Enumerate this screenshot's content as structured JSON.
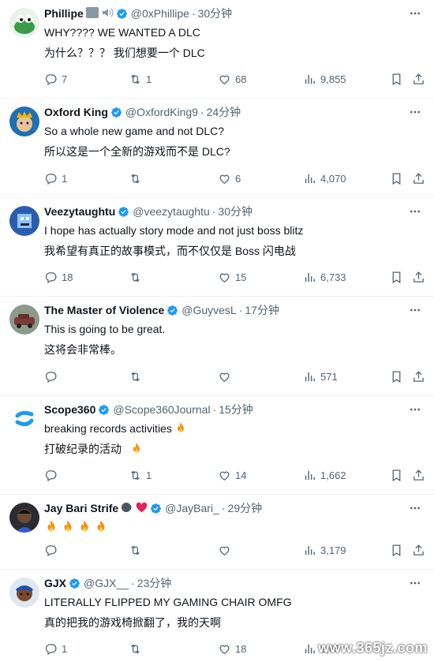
{
  "icons": {
    "verified": "verified-badge-icon",
    "more": "more-icon",
    "reply": "reply-icon",
    "retweet": "retweet-icon",
    "like": "heart-icon",
    "views": "views-icon",
    "bookmark": "bookmark-icon",
    "share": "share-icon",
    "fire": "fire-emoji"
  },
  "colors": {
    "verified": "#1d9bf0",
    "text": "#0f1419",
    "muted": "#536471",
    "divider": "#eff3f4"
  },
  "tweets": [
    {
      "name": "Phillipe",
      "handle": "@0xPhillipe",
      "time": "30分钟",
      "text": "WHY???? WE WANTED A DLC",
      "translation": "为什么？？？ 我们想要一个 DLC",
      "replies": "7",
      "retweets": "1",
      "likes": "68",
      "views": "9,855"
    },
    {
      "name": "Oxford King",
      "handle": "@OxfordKing9",
      "time": "24分钟",
      "text": "So a whole new game and not DLC?",
      "translation": "所以这是一个全新的游戏而不是 DLC?",
      "replies": "1",
      "retweets": "",
      "likes": "6",
      "views": "4,070"
    },
    {
      "name": "Veezytaughtu",
      "handle": "@veezytaughtu",
      "time": "30分钟",
      "text": "I hope has actually story mode and not just boss blitz",
      "translation": "我希望有真正的故事模式，而不仅仅是 Boss 闪电战",
      "replies": "18",
      "retweets": "",
      "likes": "15",
      "views": "6,733"
    },
    {
      "name": "The Master of Violence",
      "handle": "@GuyvesL",
      "time": "17分钟",
      "text": "This is going to be great.",
      "translation": "这将会非常棒。",
      "replies": "",
      "retweets": "",
      "likes": "",
      "views": "571"
    },
    {
      "name": "Scope360",
      "handle": "@Scope360Journal",
      "time": "15分钟",
      "text": "breaking records activities",
      "translation": "打破纪录的活动",
      "replies": "",
      "retweets": "1",
      "likes": "14",
      "views": "1,662"
    },
    {
      "name": "Jay Bari Strife",
      "handle": "@JayBari_",
      "time": "29分钟",
      "text": "",
      "translation": "",
      "replies": "",
      "retweets": "",
      "likes": "",
      "views": "3,179"
    },
    {
      "name": "GJX",
      "handle": "@GJX__",
      "time": "23分钟",
      "text": "LITERALLY FLIPPED MY GAMING CHAIR OMFG",
      "translation": "真的把我的游戏椅掀翻了，我的天啊",
      "replies": "1",
      "retweets": "",
      "likes": "18",
      "views": "2,65"
    }
  ],
  "watermark": "www.365jz.com"
}
